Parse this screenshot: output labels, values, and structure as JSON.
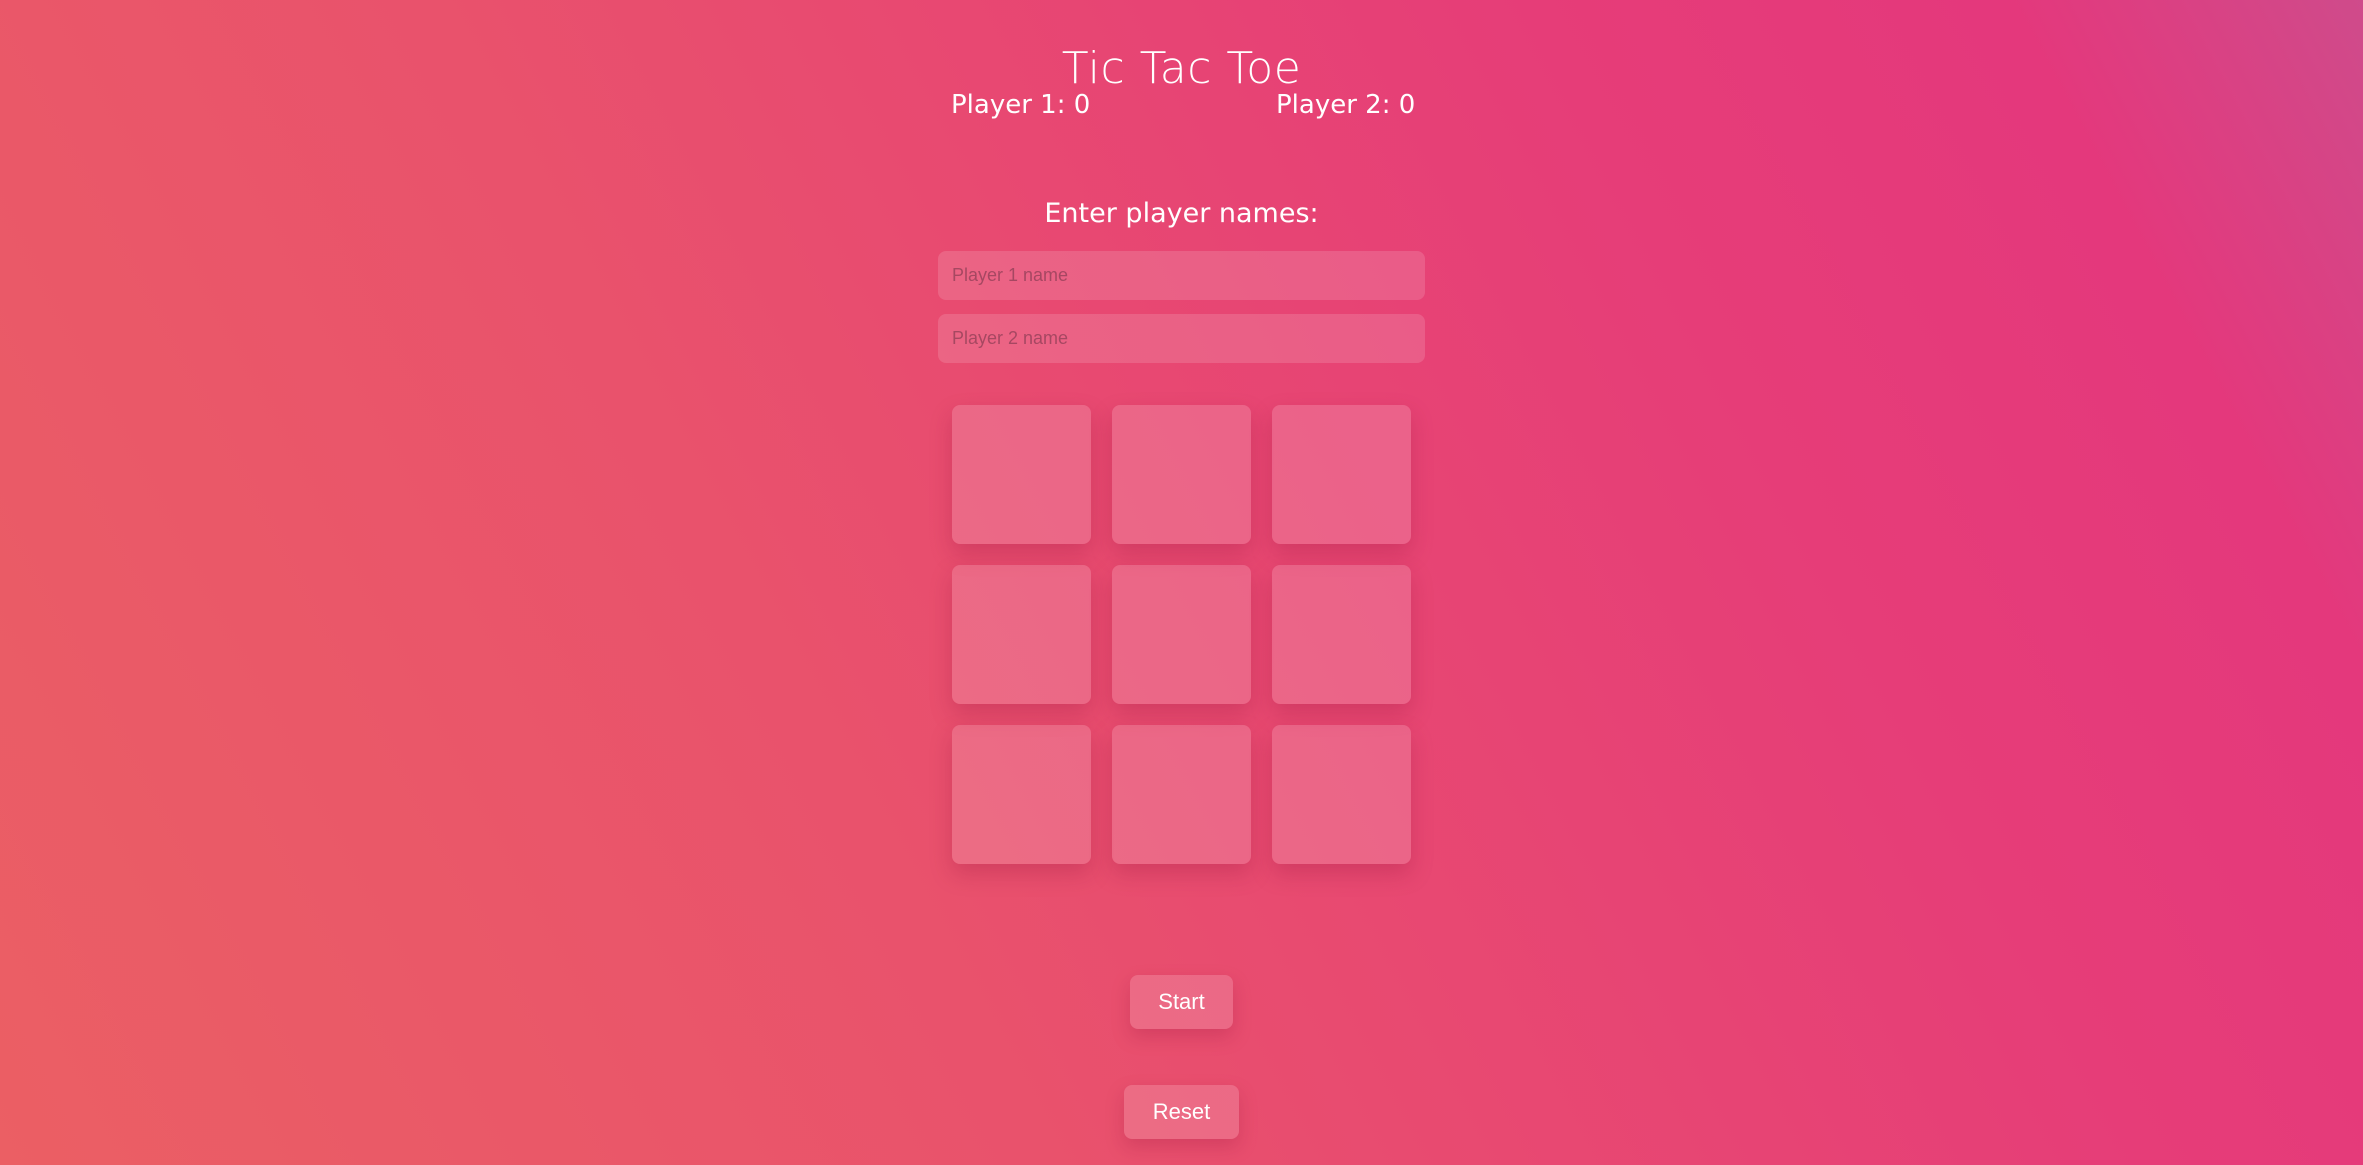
{
  "header": {
    "title": "Tic Tac Toe"
  },
  "scoreboard": {
    "player1": "Player 1: 0",
    "player2": "Player 2: 0"
  },
  "setup": {
    "label": "Enter player names:",
    "player1_input": {
      "value": "",
      "placeholder": "Player 1 name"
    },
    "player2_input": {
      "value": "",
      "placeholder": "Player 2 name"
    }
  },
  "board": {
    "cells": [
      "",
      "",
      "",
      "",
      "",
      "",
      "",
      "",
      ""
    ]
  },
  "controls": {
    "start_label": "Start",
    "reset_label": "Reset"
  },
  "colors": {
    "gradient_start": "#eb5f64",
    "gradient_mid": "#e63d78",
    "gradient_end": "#cf4b8b",
    "text": "#ffffff"
  }
}
